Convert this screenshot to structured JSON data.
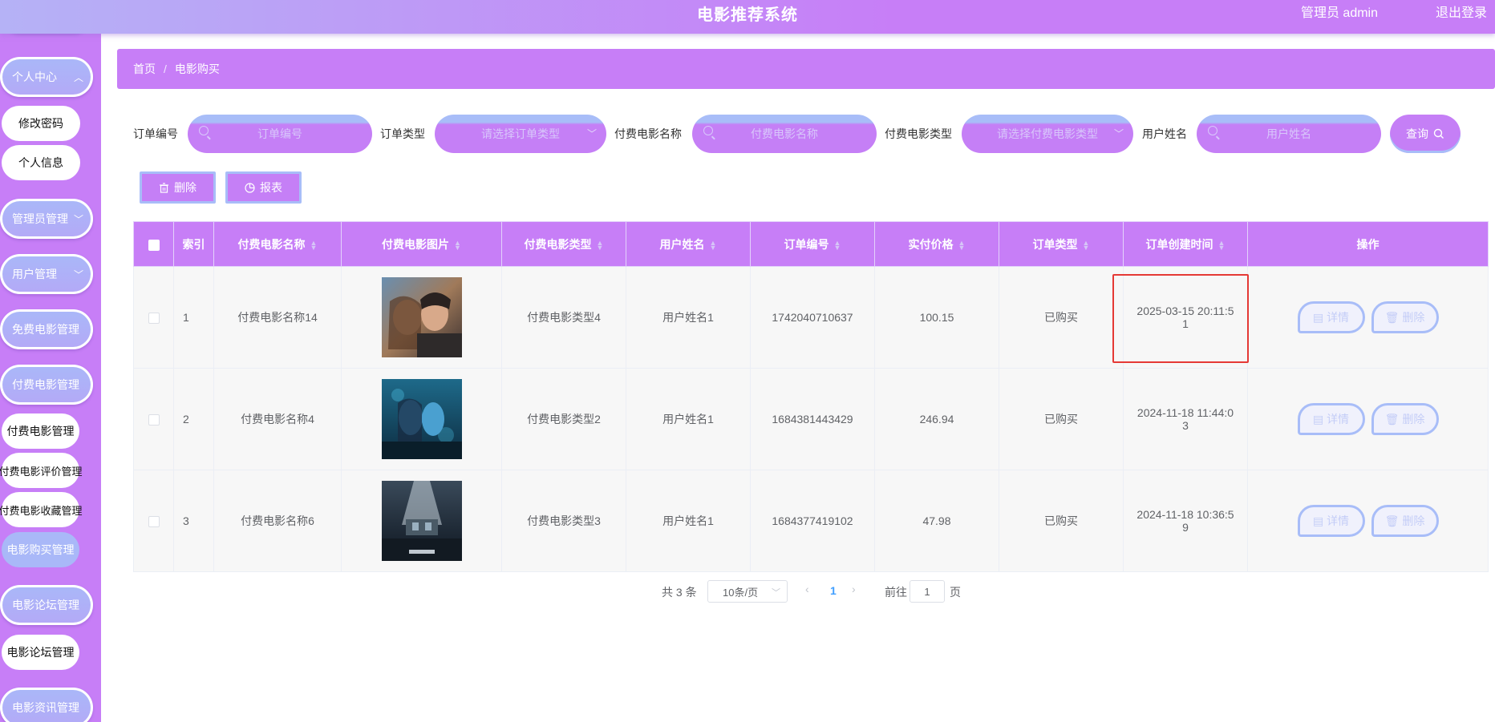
{
  "header": {
    "title": "电影推荐系统",
    "user": "管理员 admin",
    "logout": "退出登录"
  },
  "sidebar": {
    "personal_center": "个人中心",
    "change_password": "修改密码",
    "personal_info": "个人信息",
    "admin_mgmt": "管理员管理",
    "user_mgmt": "用户管理",
    "free_movie_mgmt": "免费电影管理",
    "paid_movie_group": "付费电影管理",
    "paid_movie_mgmt": "付费电影管理",
    "paid_movie_review": "付费电影评价管理",
    "paid_movie_fav": "付费电影收藏管理",
    "movie_purchase": "电影购买管理",
    "forum_group": "电影论坛管理",
    "forum_mgmt": "电影论坛管理",
    "news_group": "电影资讯管理"
  },
  "breadcrumb": {
    "home": "首页",
    "sep": "/",
    "current": "电影购买"
  },
  "search": {
    "order_no_label": "订单编号",
    "order_no_placeholder": "订单编号",
    "order_type_label": "订单类型",
    "order_type_placeholder": "请选择订单类型",
    "movie_name_label": "付费电影名称",
    "movie_name_placeholder": "付费电影名称",
    "movie_type_label": "付费电影类型",
    "movie_type_placeholder": "请选择付费电影类型",
    "user_name_label": "用户姓名",
    "user_name_placeholder": "用户姓名",
    "query": "查询"
  },
  "actions": {
    "delete": "删除",
    "report": "报表"
  },
  "table": {
    "headers": {
      "index": "索引",
      "name": "付费电影名称",
      "image": "付费电影图片",
      "type": "付费电影类型",
      "user": "用户姓名",
      "order_no": "订单编号",
      "price": "实付价格",
      "order_type": "订单类型",
      "time": "订单创建时间",
      "ops": "操作"
    },
    "detail_label": "详情",
    "delete_label": "删除",
    "rows": [
      {
        "index": "1",
        "name": "付费电影名称14",
        "type": "付费电影类型4",
        "user": "用户姓名1",
        "order_no": "1742040710637",
        "price": "100.15",
        "order_type": "已购买",
        "time_line1": "2025-03-15 20:11:5",
        "time_line2": "1"
      },
      {
        "index": "2",
        "name": "付费电影名称4",
        "type": "付费电影类型2",
        "user": "用户姓名1",
        "order_no": "1684381443429",
        "price": "246.94",
        "order_type": "已购买",
        "time_line1": "2024-11-18 11:44:0",
        "time_line2": "3"
      },
      {
        "index": "3",
        "name": "付费电影名称6",
        "type": "付费电影类型3",
        "user": "用户姓名1",
        "order_no": "1684377419102",
        "price": "47.98",
        "order_type": "已购买",
        "time_line1": "2024-11-18 10:36:5",
        "time_line2": "9"
      }
    ]
  },
  "pagination": {
    "total": "共 3 条",
    "page_size": "10条/页",
    "current": "1",
    "goto": "前往",
    "goto_value": "1",
    "page_unit": "页"
  },
  "colors": {
    "accent": "#c77ef7",
    "secondary": "#a8bdf8",
    "highlight": "#e53935"
  }
}
